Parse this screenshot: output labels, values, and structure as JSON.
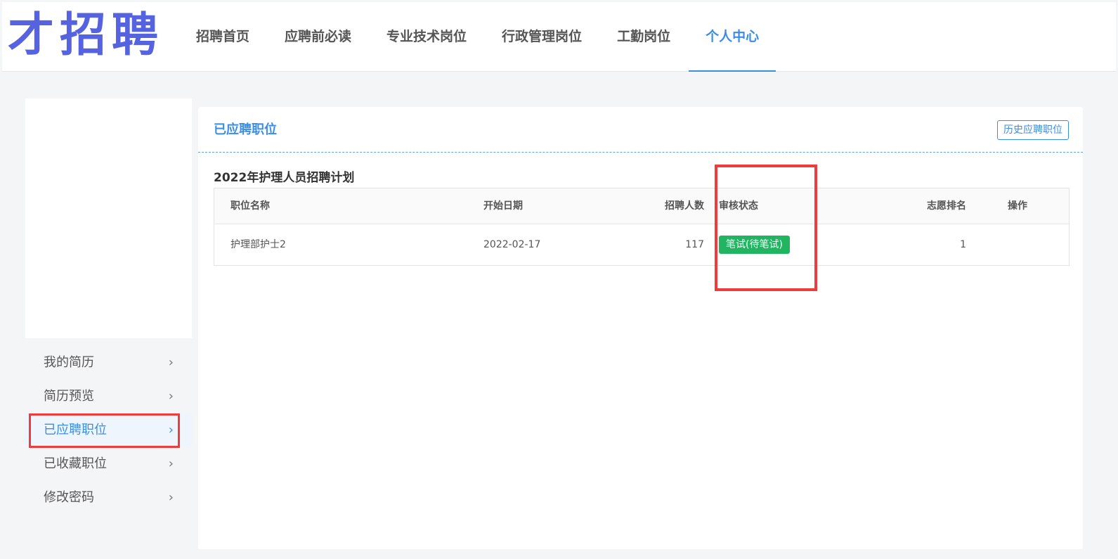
{
  "logo": {
    "text": "才招聘",
    "color": "#5663e0"
  },
  "nav": {
    "items": [
      {
        "label": "招聘首页"
      },
      {
        "label": "应聘前必读"
      },
      {
        "label": "专业技术岗位"
      },
      {
        "label": "行政管理岗位"
      },
      {
        "label": "工勤岗位"
      },
      {
        "label": "个人中心",
        "active": true
      }
    ],
    "active_color": "#3a8ee6"
  },
  "sidebar": {
    "items": [
      {
        "label": "我的简历"
      },
      {
        "label": "简历预览"
      },
      {
        "label": "已应聘职位",
        "active": true
      },
      {
        "label": "已收藏职位"
      },
      {
        "label": "修改密码"
      }
    ],
    "chevron": "chevron-right-icon"
  },
  "panel": {
    "title": "已应聘职位",
    "history_button": "历史应聘职位",
    "plan_title": "2022年护理人员招聘计划",
    "table": {
      "headers": {
        "name": "职位名称",
        "date": "开始日期",
        "count": "招聘人数",
        "status": "审核状态",
        "rank": "志愿排名",
        "op": "操作"
      },
      "rows": [
        {
          "name": "护理部护士2",
          "date": "2022-02-17",
          "count": "117",
          "status": "笔试(待笔试)",
          "rank": "1",
          "op": ""
        }
      ]
    }
  },
  "colors": {
    "accent": "#3a8ee6",
    "status_badge": "#21b562",
    "highlight": "#ef3b3b"
  }
}
